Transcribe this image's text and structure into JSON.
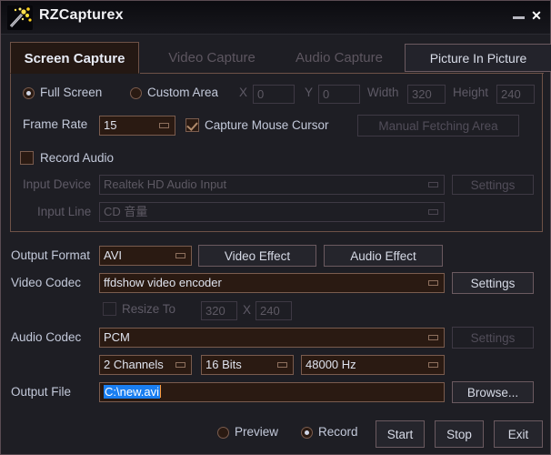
{
  "window": {
    "title": "RZCapturex",
    "icon": "magic-wand-icon",
    "minimize_label": "–",
    "close_label": "✕"
  },
  "tabs": [
    {
      "label": "Screen Capture",
      "active": true
    },
    {
      "label": "Video Capture",
      "active": false
    },
    {
      "label": "Audio Capture",
      "active": false
    }
  ],
  "pip_button": {
    "label": "Picture In Picture"
  },
  "screen_capture": {
    "full_screen": {
      "label": "Full Screen",
      "selected": true
    },
    "custom_area": {
      "label": "Custom Area",
      "selected": false
    },
    "x": {
      "label": "X",
      "value": "0",
      "enabled": false
    },
    "y": {
      "label": "Y",
      "value": "0",
      "enabled": false
    },
    "width": {
      "label": "Width",
      "value": "320",
      "enabled": false
    },
    "height": {
      "label": "Height",
      "value": "240",
      "enabled": false
    },
    "frame_rate": {
      "label": "Frame Rate",
      "value": "15",
      "enabled": true
    },
    "capture_mouse_cursor": {
      "label": "Capture Mouse Cursor",
      "checked": true
    },
    "manual_fetching_area": {
      "label": "Manual Fetching Area",
      "enabled": false
    },
    "record_audio": {
      "label": "Record Audio",
      "checked": false
    },
    "input_device": {
      "label": "Input Device",
      "value": "Realtek HD Audio Input",
      "enabled": false
    },
    "input_device_settings": {
      "label": "Settings",
      "enabled": false
    },
    "input_line": {
      "label": "Input Line",
      "value": "CD 音量",
      "enabled": false
    }
  },
  "output": {
    "output_format": {
      "label": "Output Format",
      "value": "AVI",
      "enabled": true
    },
    "video_effect": {
      "label": "Video Effect",
      "enabled": true
    },
    "audio_effect": {
      "label": "Audio Effect",
      "enabled": true
    },
    "video_codec": {
      "label": "Video Codec",
      "value": "ffdshow video encoder",
      "enabled": true
    },
    "video_codec_settings": {
      "label": "Settings",
      "enabled": true
    },
    "resize_to": {
      "label": "Resize To",
      "checked": false,
      "enabled": false
    },
    "resize_width": {
      "value": "320",
      "enabled": false
    },
    "resize_x": {
      "label": "X"
    },
    "resize_height": {
      "value": "240",
      "enabled": false
    },
    "audio_codec": {
      "label": "Audio Codec",
      "value": "PCM",
      "enabled": true
    },
    "audio_codec_settings": {
      "label": "Settings",
      "enabled": false
    },
    "channels": {
      "value": "2 Channels",
      "enabled": true
    },
    "bits": {
      "value": "16 Bits",
      "enabled": true
    },
    "sample_rate": {
      "value": "48000 Hz",
      "enabled": true
    },
    "output_file": {
      "label": "Output File",
      "value": "C:\\new.avi",
      "selected": true
    },
    "browse": {
      "label": "Browse..."
    }
  },
  "actions": {
    "preview": {
      "label": "Preview",
      "selected": false
    },
    "record": {
      "label": "Record",
      "selected": true
    },
    "start": {
      "label": "Start"
    },
    "stop": {
      "label": "Stop"
    },
    "exit": {
      "label": "Exit"
    }
  }
}
